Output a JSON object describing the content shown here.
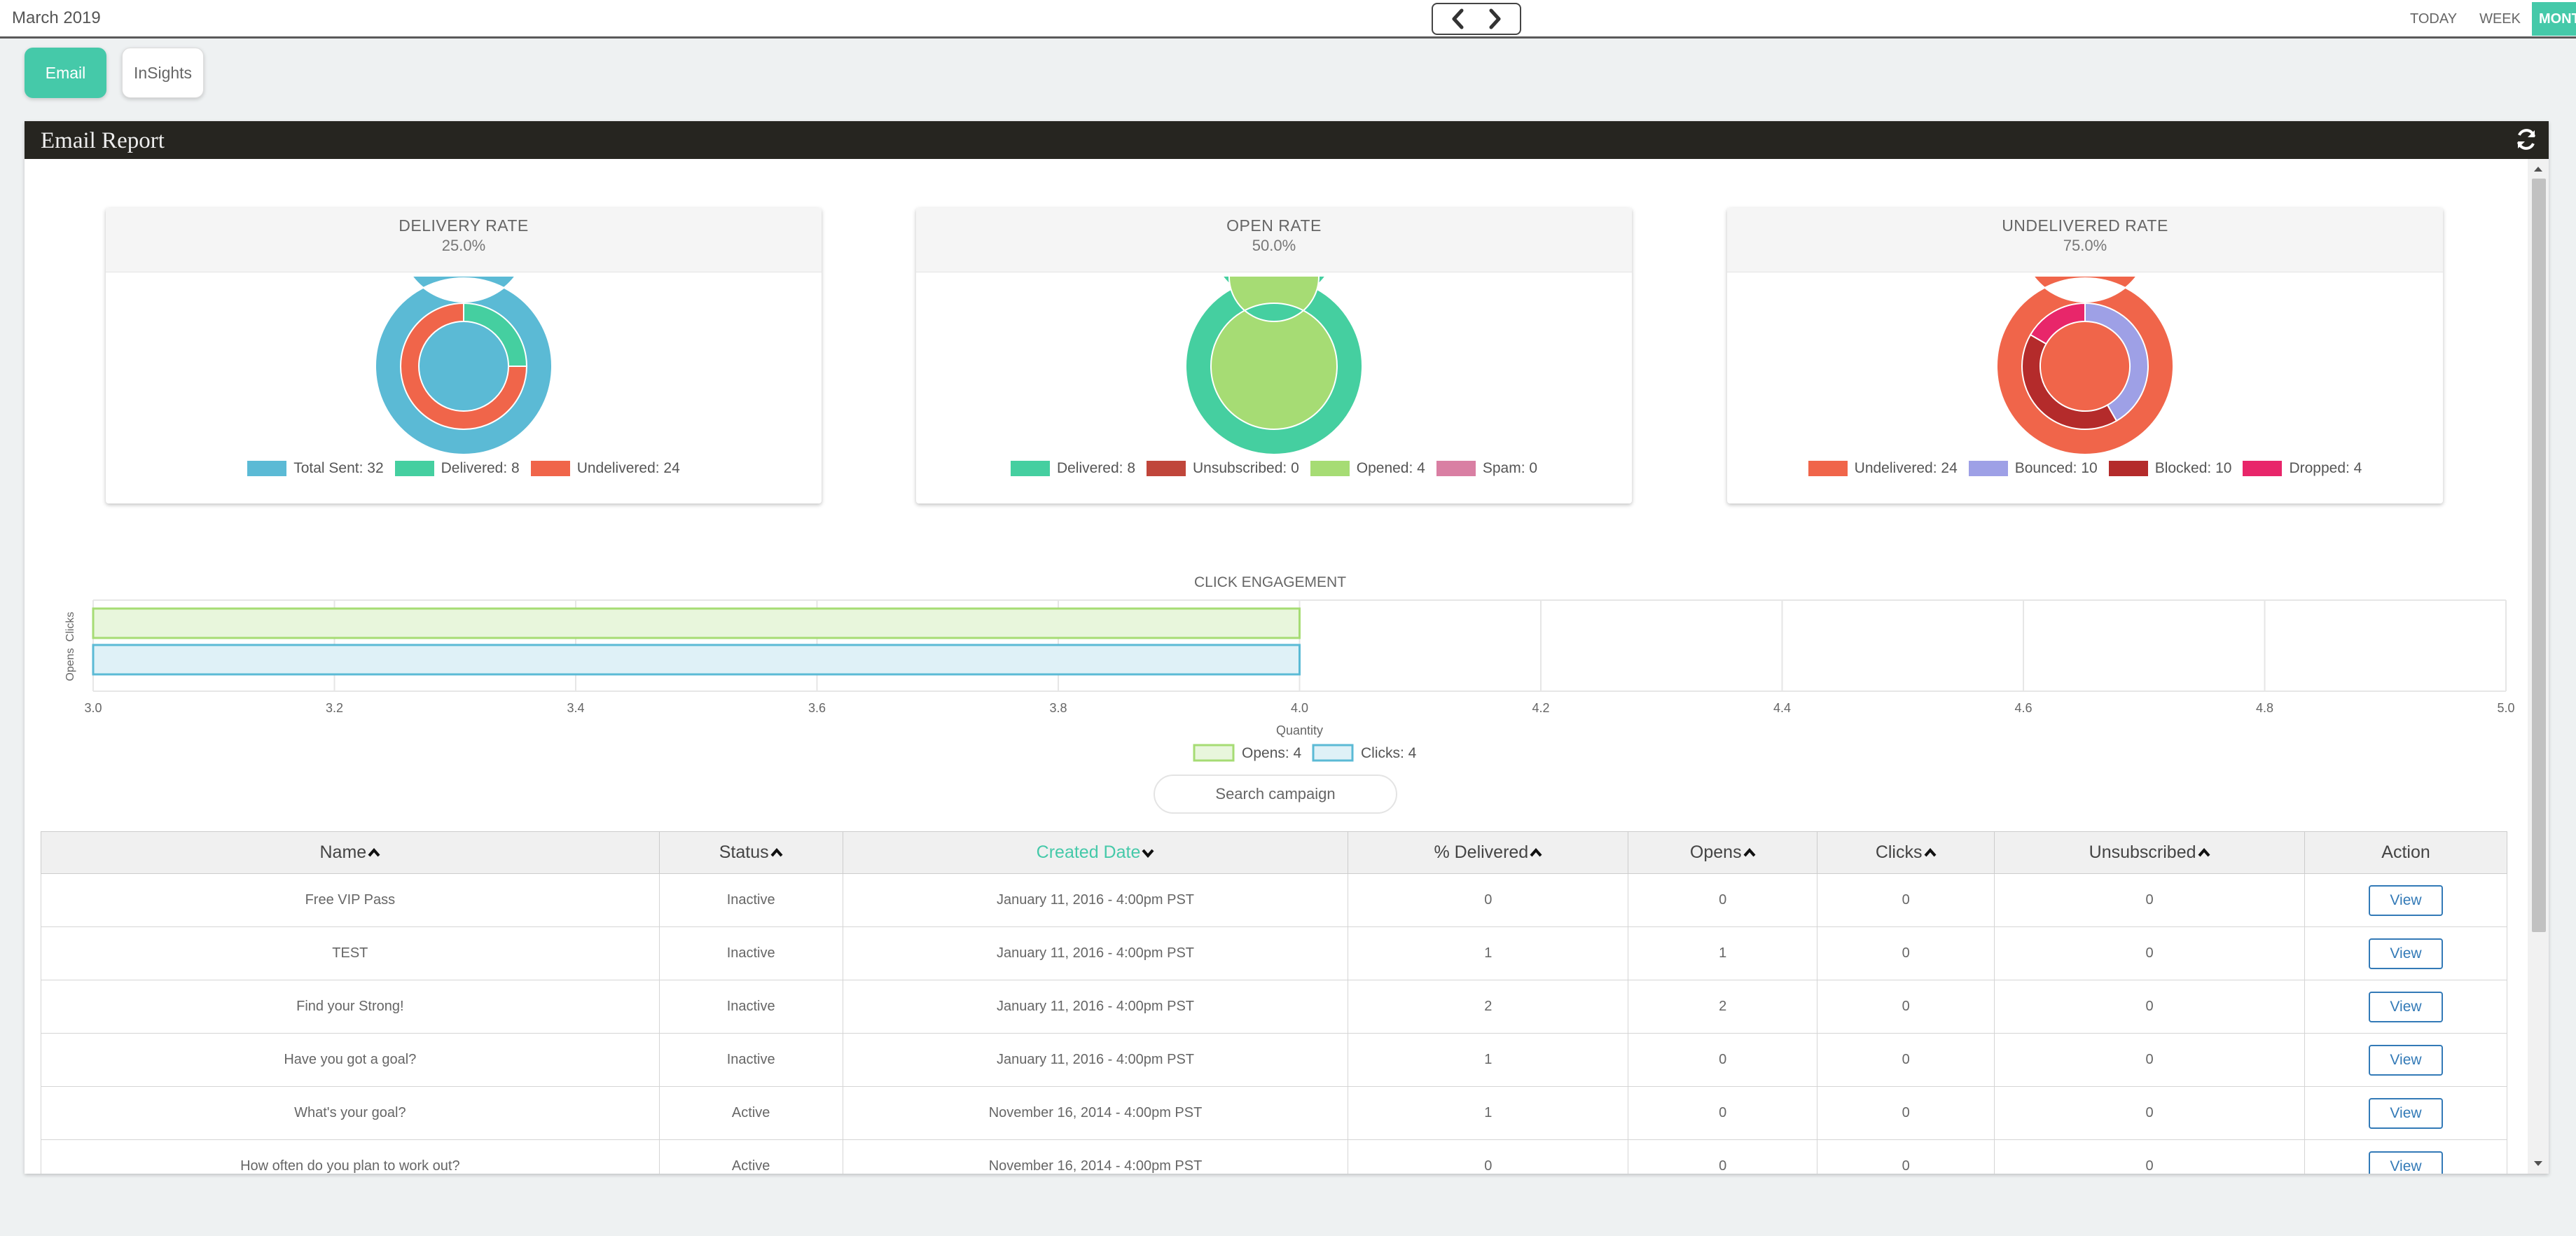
{
  "topbar": {
    "month": "March 2019",
    "views": [
      "TODAY",
      "WEEK",
      "MONTH"
    ]
  },
  "tabs": {
    "email": "Email",
    "insights": "InSights"
  },
  "panel": {
    "title": "Email Report"
  },
  "cards": [
    {
      "title": "DELIVERY RATE",
      "value": "25.0%",
      "legend": [
        {
          "label": "Total Sent: 32",
          "color": "#5bbad5"
        },
        {
          "label": "Delivered: 8",
          "color": "#45cfa0"
        },
        {
          "label": "Undelivered: 24",
          "color": "#f0654a"
        }
      ]
    },
    {
      "title": "OPEN RATE",
      "value": "50.0%",
      "legend": [
        {
          "label": "Delivered: 8",
          "color": "#45cfa0"
        },
        {
          "label": "Unsubscribed: 0",
          "color": "#c0463b"
        },
        {
          "label": "Opened: 4",
          "color": "#a6dc74"
        },
        {
          "label": "Spam: 0",
          "color": "#d97fa3"
        }
      ]
    },
    {
      "title": "UNDELIVERED RATE",
      "value": "75.0%",
      "legend": [
        {
          "label": "Undelivered: 24",
          "color": "#f0654a"
        },
        {
          "label": "Bounced: 10",
          "color": "#9ea0e6"
        },
        {
          "label": "Blocked: 10",
          "color": "#b42b2b"
        },
        {
          "label": "Dropped: 4",
          "color": "#e8266a"
        }
      ]
    }
  ],
  "chart_data": [
    {
      "type": "pie",
      "title": "DELIVERY RATE",
      "outer": [
        {
          "name": "Total Sent",
          "value": 32
        }
      ],
      "inner": [
        {
          "name": "Delivered",
          "value": 8
        },
        {
          "name": "Undelivered",
          "value": 24
        }
      ]
    },
    {
      "type": "pie",
      "title": "OPEN RATE",
      "outer": [
        {
          "name": "Delivered",
          "value": 8
        },
        {
          "name": "Unsubscribed",
          "value": 0
        }
      ],
      "inner": [
        {
          "name": "Opened",
          "value": 4
        },
        {
          "name": "Spam",
          "value": 0
        }
      ]
    },
    {
      "type": "pie",
      "title": "UNDELIVERED RATE",
      "outer": [
        {
          "name": "Undelivered",
          "value": 24
        }
      ],
      "inner": [
        {
          "name": "Bounced",
          "value": 10
        },
        {
          "name": "Blocked",
          "value": 10
        },
        {
          "name": "Dropped",
          "value": 4
        }
      ]
    },
    {
      "type": "bar",
      "title": "CLICK ENGAGEMENT",
      "orientation": "horizontal",
      "categories": [
        "Clicks",
        "Opens"
      ],
      "values": [
        4,
        4
      ],
      "xlabel": "Quantity",
      "xlim": [
        3.0,
        5.0
      ],
      "xticks": [
        "3.0",
        "3.2",
        "3.4",
        "3.6",
        "3.8",
        "4.0",
        "4.2",
        "4.4",
        "4.6",
        "4.8",
        "5.0"
      ],
      "legend": [
        {
          "label": "Opens: 4",
          "color": "#a6dc74"
        },
        {
          "label": "Clicks: 4",
          "color": "#5bbad5"
        }
      ]
    }
  ],
  "search": {
    "placeholder": "Search campaign"
  },
  "table": {
    "headers": [
      "Name",
      "Status",
      "Created Date",
      "% Delivered",
      "Opens",
      "Clicks",
      "Unsubscribed",
      "Action"
    ],
    "rows": [
      [
        "Free VIP Pass",
        "Inactive",
        "January 11, 2016 - 4:00pm PST",
        "0",
        "0",
        "0",
        "0",
        "View"
      ],
      [
        "TEST",
        "Inactive",
        "January 11, 2016 - 4:00pm PST",
        "1",
        "1",
        "0",
        "0",
        "View"
      ],
      [
        "Find your Strong!",
        "Inactive",
        "January 11, 2016 - 4:00pm PST",
        "2",
        "2",
        "0",
        "0",
        "View"
      ],
      [
        "Have you got a goal?",
        "Inactive",
        "January 11, 2016 - 4:00pm PST",
        "1",
        "0",
        "0",
        "0",
        "View"
      ],
      [
        "What's your goal?",
        "Active",
        "November 16, 2014 - 4:00pm PST",
        "1",
        "0",
        "0",
        "0",
        "View"
      ],
      [
        "How often do you plan to work out?",
        "Active",
        "November 16, 2014 - 4:00pm PST",
        "0",
        "0",
        "0",
        "0",
        "View"
      ]
    ]
  }
}
